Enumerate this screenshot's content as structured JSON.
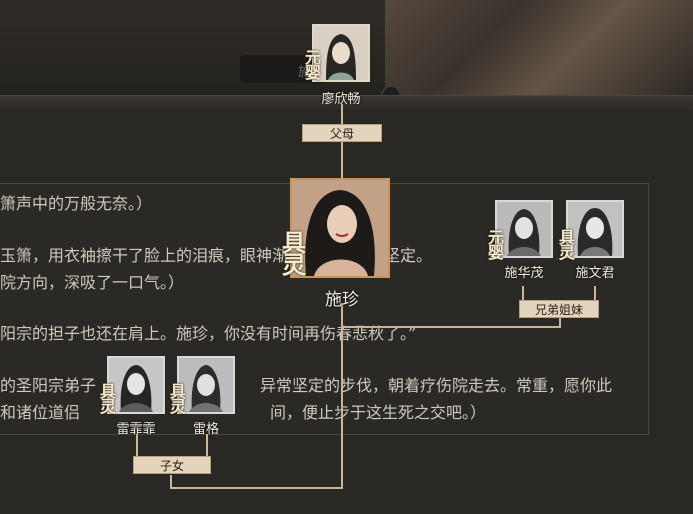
{
  "scene": {
    "title_partial": "施",
    "dialog_lines": [
      "箫声中的万般无奈。）",
      "玉箫，用衣袖擦干了脸上的泪痕，眼神渐渐变得清明而坚定。",
      "院方向，深吸了一口气。）",
      "阳宗的担子也还在肩上。施珍，你没有时间再伤春悲秋了。”",
      "的圣阳宗弟子",
      "异常坚定的步伐，朝着疗伤院走去。常重，愿你此",
      "和诸位道侣",
      "间，便止步于这生死之交吧。）"
    ]
  },
  "tree": {
    "parent": {
      "name": "廖欣畅",
      "status": "元婴"
    },
    "parents_tag": "父母",
    "main": {
      "name": "施珍",
      "status": "具灵"
    },
    "siblings_tag": "兄弟姐妹",
    "siblings": [
      {
        "name": "施华茂",
        "status": "元婴"
      },
      {
        "name": "施文君",
        "status": "具灵"
      }
    ],
    "children_tag": "子女",
    "children": [
      {
        "name": "雷霏霏",
        "status": "具灵"
      },
      {
        "name": "雷格",
        "status": "具灵"
      }
    ]
  }
}
